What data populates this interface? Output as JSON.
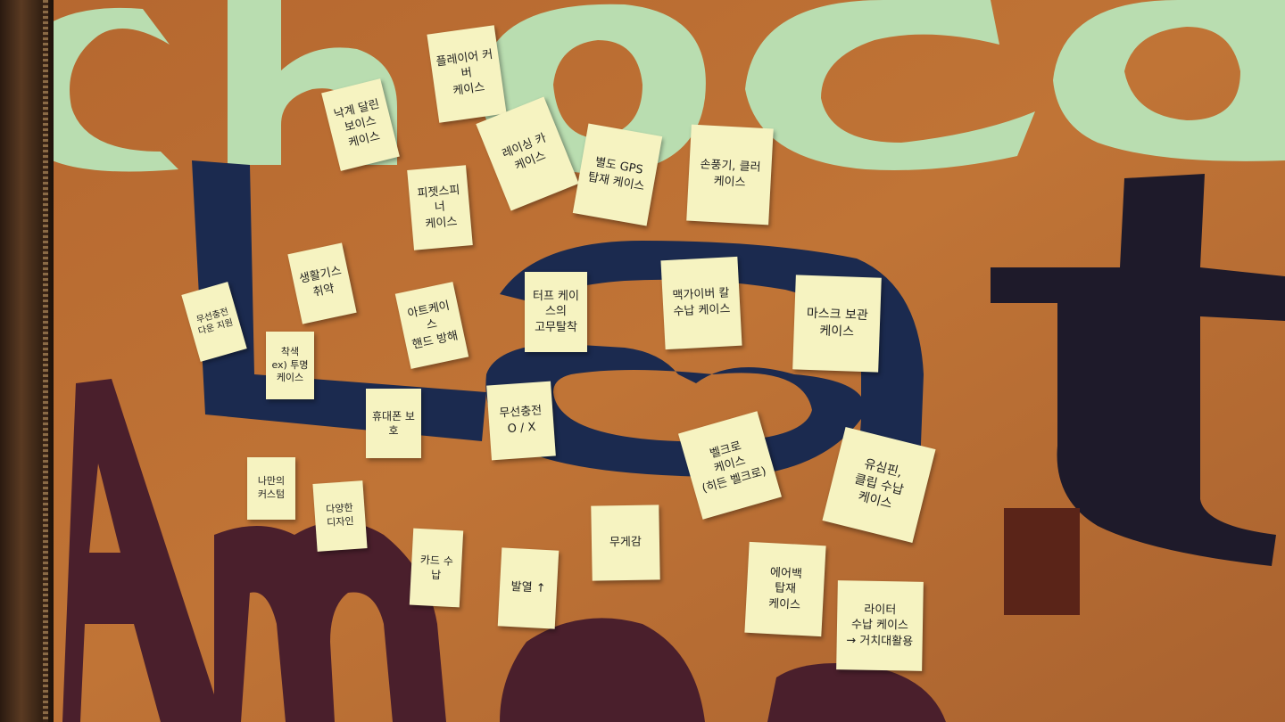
{
  "notes": [
    "플레이어 커버\n케이스",
    "낙계 달린\n보이스\n케이스",
    "레이싱 카\n케이스",
    "별도 GPS\n탑재 케이스",
    "손풍기, 클러\n케이스",
    "피젯스피너\n케이스",
    "생활기스\n취약",
    "무선충전\n다운 지원",
    "아트케이스\n핸드 방해",
    "터프 케이스의\n고무탈착",
    "맥가이버 칼\n수납 케이스",
    "마스크 보관\n케이스",
    "착색\nex) 투명케이스",
    "휴대폰 보호",
    "무선충전\nO / X",
    "벨크로\n케이스\n(히든 벨크로)",
    "유심핀,\n클립 수납\n케이스",
    "나만의\n커스텀",
    "다양한\n디자인",
    "카드 수납",
    "발열 ↑",
    "무게감",
    "에어백\n탑재\n케이스",
    "라이터\n수납 케이스\n→ 거치대활용"
  ]
}
